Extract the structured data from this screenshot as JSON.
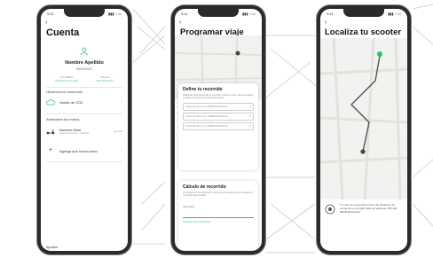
{
  "status_time": "9:41",
  "phones": [
    {
      "title": "Cuenta",
      "user_name": "Nombre Apellido",
      "user_date": "00/00/2021",
      "stats": [
        {
          "label": "Km totales",
          "value": "Recorridos en total"
        },
        {
          "label": "Ahorro",
          "value": "CO2 ahorrado"
        }
      ],
      "section_impact": "Observa tus consumos",
      "impact_item": "Huella de CO2",
      "section_scooters": "Administra tus motos",
      "scooter_name": "Nombre Moto",
      "scooter_sub": "Datos del scooter · matrícula",
      "scooter_tag": "Ver más",
      "add_scooter": "Agrega una nueva moto",
      "section_settings": "Ajustes"
    },
    {
      "title": "Programar viaje",
      "card1_title": "Define tu recorrido",
      "card1_desc": "Añade las direcciones de tu recorrido, indica el orden de las paradas y calcula el tiempo estimado del trayecto",
      "fields": [
        "Punto de Inicio: Av. 200000 Barcelona",
        "Punto de Inicio: Av. 140000 Barcelona",
        "Punto de Inicio: Av. 000000 Barcelona"
      ],
      "card2_title": "Cálculo de recorrido",
      "card2_desc": "Te ofrecemos una estimación del tiempo necesario para completar el recorrido seleccionado",
      "input_label": "Velocidad",
      "footer": "Guardar ruta en favoritos"
    },
    {
      "title": "Localiza tu scooter",
      "info_text": "Tu moto se encuentra a 247m de distancia. Se encuentra en la calle Calle de Valencia, 239-160, 08036 Barcelona"
    }
  ],
  "colors": {
    "accent": "#2bbf6a",
    "frame": "#2b2b2b"
  }
}
